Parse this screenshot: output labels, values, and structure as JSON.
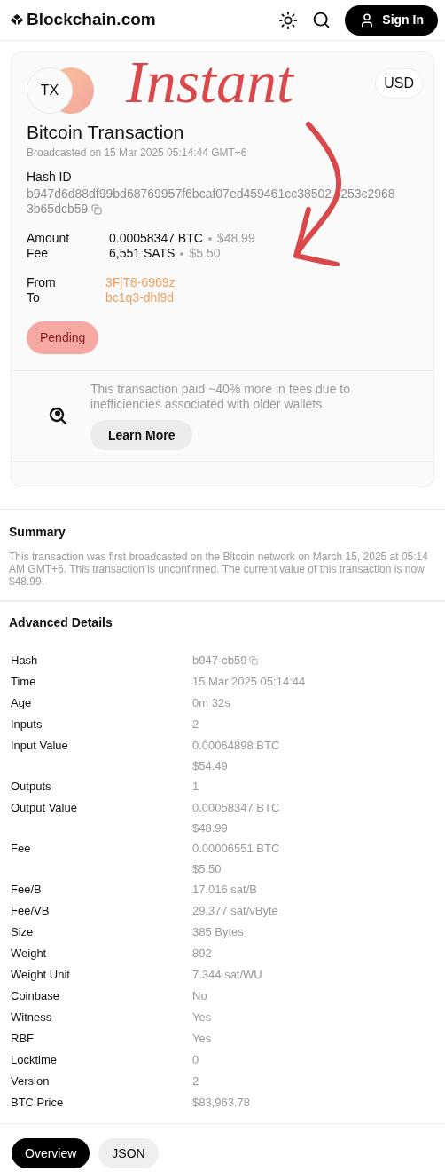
{
  "header": {
    "brand": "Blockchain.com",
    "sign_in": "Sign In"
  },
  "annotation": {
    "text": "Instant"
  },
  "card": {
    "avatar": "TX",
    "currency": "USD",
    "title": "Bitcoin Transaction",
    "broadcast": "Broadcasted on 15 Mar 2025 05:14:44 GMT+6",
    "hash_label": "Hash ID",
    "hash_parts": [
      "b947d6d88df99bd68769957f6bcaf07ed459461cc38502",
      "253c2968",
      "3b65dcb59"
    ],
    "amounts": [
      {
        "label": "Amount",
        "value": "0.00058347 BTC",
        "fiat": "$48.99"
      },
      {
        "label": "Fee",
        "value": "6,551 SATS",
        "fiat": "$5.50"
      }
    ],
    "parties": [
      {
        "label": "From",
        "address": "3FjT8-6969z"
      },
      {
        "label": "To",
        "address": "bc1q3-dhl9d"
      }
    ],
    "status": "Pending",
    "tip": {
      "text": "This transaction paid ~40% more in fees due to inefficiencies associated with older wallets.",
      "button": "Learn More"
    }
  },
  "summary": {
    "title": "Summary",
    "text": "This transaction was first broadcasted on the Bitcoin network on March 15, 2025 at 05:14 AM GMT+6. This transaction is unconfirmed. The current value of this transaction is now $48.99."
  },
  "advanced": {
    "title": "Advanced Details",
    "rows": [
      {
        "label": "Hash",
        "values": [
          "b947-cb59"
        ],
        "copy": true
      },
      {
        "label": "Time",
        "values": [
          "15 Mar 2025 05:14:44"
        ],
        "copy": false
      },
      {
        "label": "Age",
        "values": [
          "0m 32s"
        ],
        "copy": false
      },
      {
        "label": "Inputs",
        "values": [
          "2"
        ],
        "copy": false
      },
      {
        "label": "Input Value",
        "values": [
          "0.00064898 BTC",
          "$54.49"
        ],
        "copy": false
      },
      {
        "label": "Outputs",
        "values": [
          "1"
        ],
        "copy": false
      },
      {
        "label": "Output Value",
        "values": [
          "0.00058347 BTC",
          "$48.99"
        ],
        "copy": false
      },
      {
        "label": "Fee",
        "values": [
          "0.00006551 BTC",
          "$5.50"
        ],
        "copy": false
      },
      {
        "label": "Fee/B",
        "values": [
          "17.016 sat/B"
        ],
        "copy": false
      },
      {
        "label": "Fee/VB",
        "values": [
          "29.377 sat/vByte"
        ],
        "copy": false
      },
      {
        "label": "Size",
        "values": [
          "385 Bytes"
        ],
        "copy": false
      },
      {
        "label": "Weight",
        "values": [
          "892"
        ],
        "copy": false
      },
      {
        "label": "Weight Unit",
        "values": [
          "7.344 sat/WU"
        ],
        "copy": false
      },
      {
        "label": "Coinbase",
        "values": [
          "No"
        ],
        "copy": false
      },
      {
        "label": "Witness",
        "values": [
          "Yes"
        ],
        "copy": false
      },
      {
        "label": "RBF",
        "values": [
          "Yes"
        ],
        "copy": false
      },
      {
        "label": "Locktime",
        "values": [
          "0"
        ],
        "copy": false
      },
      {
        "label": "Version",
        "values": [
          "2"
        ],
        "copy": false
      },
      {
        "label": "BTC Price",
        "values": [
          "$83,963.78"
        ],
        "copy": false
      }
    ]
  },
  "tabs": [
    {
      "label": "Overview",
      "selected": true
    },
    {
      "label": "JSON",
      "selected": false
    }
  ]
}
